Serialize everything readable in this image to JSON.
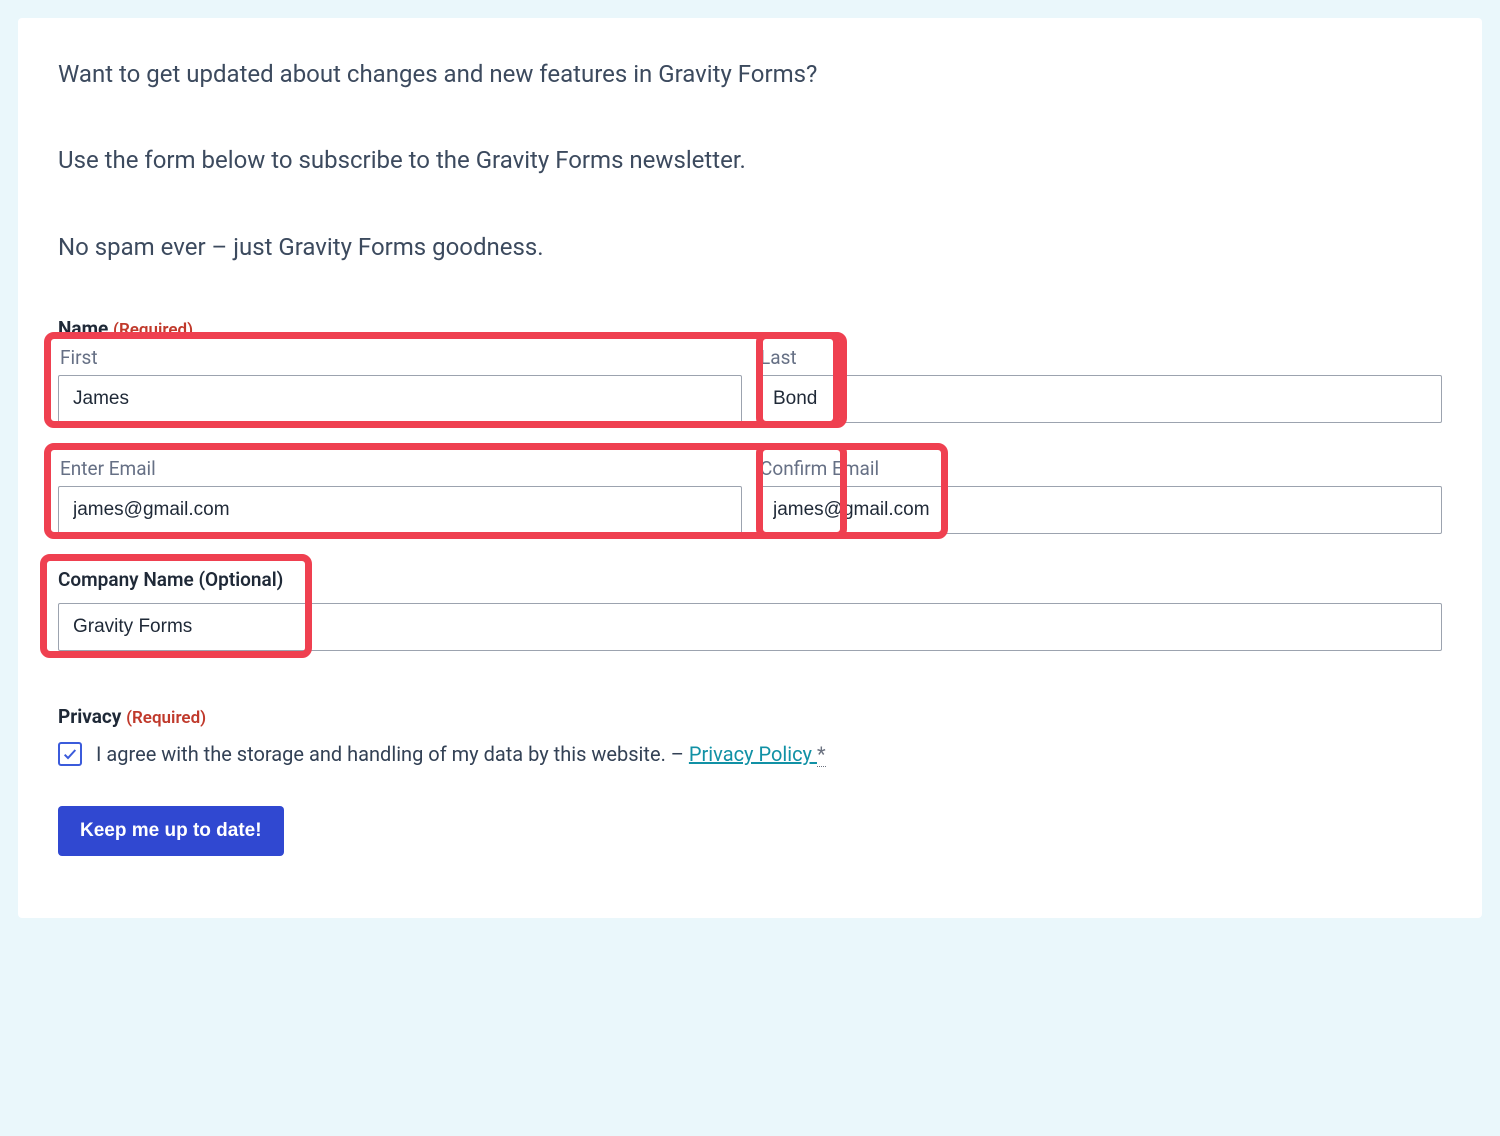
{
  "intro": {
    "line1": "Want to get updated about changes and new features in Gravity Forms?",
    "line2": "Use the form below to subscribe to the Gravity Forms newsletter.",
    "line3": "No spam ever – just Gravity Forms goodness."
  },
  "name": {
    "label": "Name",
    "required": "(Required)",
    "first_label": "First",
    "first_value": "James",
    "last_label": "Last",
    "last_value": "Bond"
  },
  "email": {
    "enter_label": "Enter Email",
    "enter_value": "james@gmail.com",
    "confirm_label": "Confirm Email",
    "confirm_value": "james@gmail.com"
  },
  "company": {
    "label": "Company Name (Optional)",
    "value": "Gravity Forms"
  },
  "privacy": {
    "label": "Privacy",
    "required": "(Required)",
    "consent_prefix": "I agree with the storage and handling of my data by this website. – ",
    "policy_link_text": "Privacy Policy ",
    "asterisk": "*",
    "checked": true
  },
  "submit": {
    "label": "Keep me up to date!"
  }
}
